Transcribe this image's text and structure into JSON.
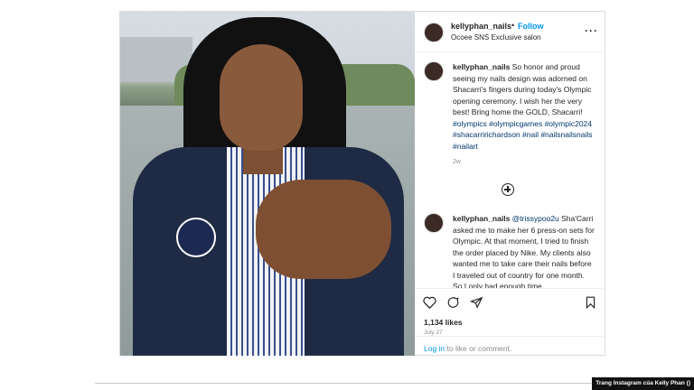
{
  "post": {
    "username": "kellyphan_nails",
    "follow_label": "Follow",
    "subtitle": "Ocoee SNS Exclusive salon",
    "dot": "•",
    "more": "···"
  },
  "comments": [
    {
      "username": "kellyphan_nails",
      "text": " So honor and proud seeing my nails design was adorned on Shacarri's fingers during today's Olympic opening ceremony. I wish her the very best! Bring home the GOLD, Shacarri! ",
      "hashtags": "#olympics #olympicgames #olympic2024 #shacarririchardson #nail #nailsnailsnails #nailart",
      "time": "2w"
    },
    {
      "username": "kellyphan_nails",
      "mention": " @trissypoo2u",
      "text": " Sha'Carri asked me to make her 6 press-on sets for Olympic. At that moment, I tried to finish the order placed by Nike. My clients also wanted me to take care their nails before I traveled out of country for one month. So I only had enough time"
    }
  ],
  "icons": {
    "like": "heart-icon",
    "comment": "comment-icon",
    "share": "paper-plane-icon",
    "save": "bookmark-icon",
    "add": "plus-circle-icon"
  },
  "likes": "1,134 likes",
  "date": "July 27",
  "login": {
    "link": "Log in",
    "rest": " to like or comment."
  },
  "credit": "Trang Instagram của Kelly Phan ()",
  "colors": {
    "link_blue": "#0095f6",
    "hashtag": "#00376b",
    "text": "#262626",
    "muted": "#8e8e8e"
  }
}
